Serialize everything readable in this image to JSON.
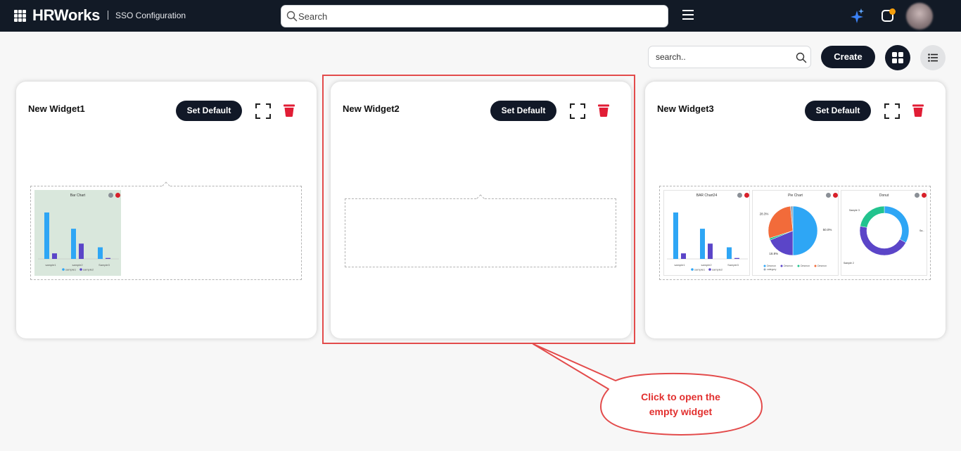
{
  "header": {
    "brand": "HRWorks",
    "page_subtitle": "SSO Configuration",
    "search_placeholder": "Search"
  },
  "toolbar": {
    "search_placeholder": "search..",
    "create_label": "Create"
  },
  "widgets": [
    {
      "title": "New Widget1",
      "set_default_label": "Set Default",
      "charts": [
        {
          "type": "bar",
          "title": "Bar Chart",
          "categories": [
            "sample1",
            "sample2",
            "Sample3"
          ],
          "series": [
            {
              "name": "sample1",
              "color": "#2ea6f5",
              "values": [
                100,
                65,
                25
              ]
            },
            {
              "name": "sample2",
              "color": "#5b45c8",
              "values": [
                12,
                33,
                2
              ]
            }
          ],
          "background": "#d9e7dc"
        }
      ]
    },
    {
      "title": "New Widget2",
      "set_default_label": "Set Default",
      "charts": []
    },
    {
      "title": "New Widget3",
      "set_default_label": "Set Default",
      "charts": [
        {
          "type": "bar",
          "title": "BAR Chart24",
          "categories": [
            "sample1",
            "sample2",
            "Sample3"
          ],
          "series": [
            {
              "name": "sample1",
              "color": "#2ea6f5",
              "values": [
                100,
                65,
                25
              ]
            },
            {
              "name": "sample2",
              "color": "#5b45c8",
              "values": [
                12,
                33,
                2
              ]
            }
          ],
          "background": "#ffffff"
        },
        {
          "type": "pie",
          "title": "Pie Chart",
          "slices": [
            {
              "value": 50.0,
              "label": "50.0%",
              "color": "#2ea6f5"
            },
            {
              "value": 18.8,
              "label": "18.8%",
              "color": "#5b45c8"
            },
            {
              "value": 1.3,
              "label": "",
              "color": "#22c38e"
            },
            {
              "value": 28.3,
              "label": "28.3%",
              "color": "#f26b3a"
            },
            {
              "value": 1.6,
              "label": "",
              "color": "#9aa7b5"
            }
          ],
          "legend": [
            "Desmon",
            "Desmon",
            "Desmon",
            "Desmon",
            "category"
          ]
        },
        {
          "type": "donut",
          "title": "Donut",
          "slices": [
            {
              "value": 33,
              "color": "#2ea6f5"
            },
            {
              "value": 45,
              "color": "#5b45c8"
            },
            {
              "value": 22,
              "color": "#22c38e"
            }
          ],
          "labels": [
            "Sample 3",
            "Sample 2",
            "Sa..."
          ]
        }
      ]
    }
  ],
  "annotation": {
    "line1": "Click to open the",
    "line2": "empty widget",
    "color": "#e2302f"
  },
  "colors": {
    "topbar": "#121a26",
    "button_dark": "#111827",
    "accent_blue": "#2ea6f5",
    "accent_purple": "#5b45c8",
    "trash_red": "#e11d35"
  }
}
